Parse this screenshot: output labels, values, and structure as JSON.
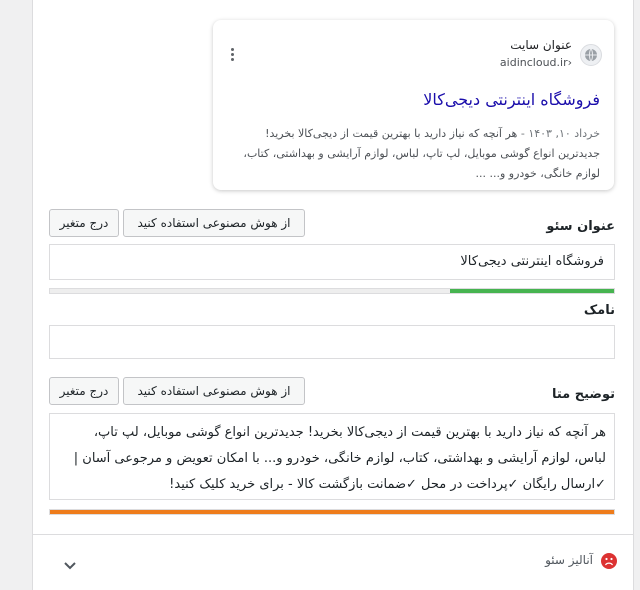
{
  "serp_preview": {
    "site_name": "عنوان سایت",
    "site_url": "aidincloud.ir›",
    "title": "فروشگاه اینترنتی دیجی‌کالا",
    "date": "خرداد ۱۰, ۱۴۰۳  -  ",
    "description": "هر آنچه که نیاز دارید با بهترین قیمت از دیجی‌کالا بخرید! جدیدترین انواع گوشی موبایل، لپ تاپ، لباس، لوازم آرایشی و بهداشتی، کتاب، لوازم خانگی، خودرو و... ..."
  },
  "seo_title": {
    "label": "عنوان سئو",
    "ai_button": "از هوش مصنوعی استفاده کنید",
    "var_button": "درج متغیر",
    "value": "فروشگاه اینترنتی دیجی‌کالا",
    "progress": 0.29,
    "progress_color": "#46b450"
  },
  "slug": {
    "label": "نامک",
    "value": ""
  },
  "meta_description": {
    "label": "توضیح متا",
    "ai_button": "از هوش مصنوعی استفاده کنید",
    "var_button": "درج متغیر",
    "value": "هر آنچه که نیاز دارید با بهترین قیمت از دیجی‌کالا بخرید! جدیدترین انواع گوشی موبایل، لپ تاپ، لباس، لوازم آرایشی و بهداشتی، کتاب، لوازم خانگی، خودرو و... با امکان تعویض و مرجوعی آسان | ✓ارسال رایگان ✓پرداخت در محل ✓ضمانت بازگشت کالا - برای خرید کلیک کنید!",
    "progress": 1.0,
    "progress_color": "#ee7c1b"
  },
  "seo_analysis": {
    "label": "آنالیز سئو",
    "status_color": "#dc3232"
  }
}
